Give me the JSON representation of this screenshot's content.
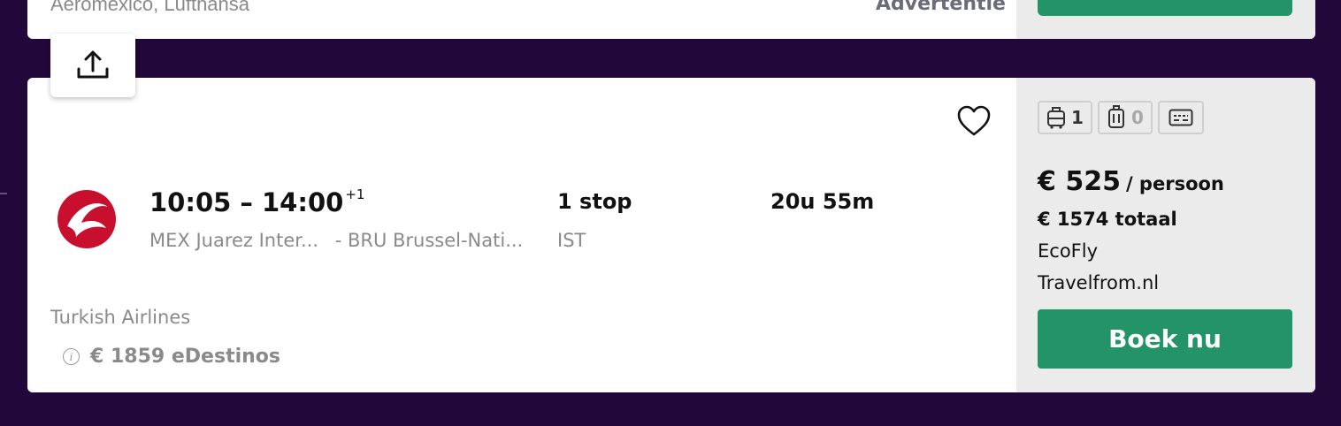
{
  "previous_result": {
    "airlines": "Aeromexico, Lufthansa",
    "ad_label": "Advertentie"
  },
  "result": {
    "times": "10:05 – 14:00",
    "day_offset": "+1",
    "origin": "MEX Juarez Inter...",
    "destination": "- BRU Brussel-Nati...",
    "stops": "1 stop",
    "layover": "IST",
    "duration": "20u 55m",
    "airline": "Turkish Airlines",
    "alt_price": "€ 1859",
    "alt_provider": "eDestinos",
    "bags": {
      "carry_on": "1",
      "checked": "0"
    },
    "price_per_person": "€ 525",
    "per_person_label": "/ persoon",
    "total_price": "€ 1574 totaal",
    "fare_class": "EcoFly",
    "provider": "Travelfrom.nl",
    "book_label": "Boek nu"
  },
  "icons": [
    "share-icon",
    "heart-icon",
    "turkish-airlines-logo",
    "carry-on-bag-icon",
    "checked-bag-icon",
    "ticket-icon",
    "info-icon"
  ],
  "colors": {
    "background": "#22073a",
    "accent_green": "#229467",
    "side_panel": "#ebebeb",
    "logo_red": "#c8102e"
  }
}
